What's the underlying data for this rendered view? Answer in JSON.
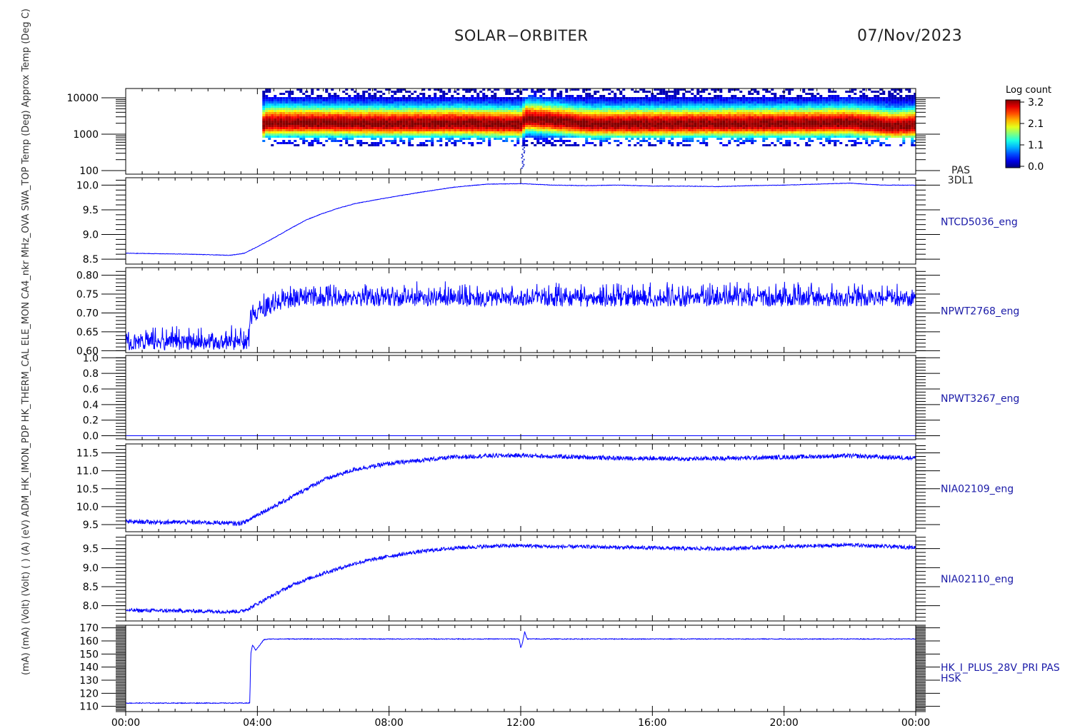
{
  "header": {
    "mission": "SOLAR−ORBITER",
    "date": "07/Nov/2023"
  },
  "colorbar": {
    "title": "Log count",
    "ticks": [
      "3.2",
      "2.1",
      "1.1",
      "0.0"
    ]
  },
  "colors": {
    "axes": "#000000",
    "trace": "#0000ff",
    "label": "#1a1aa8"
  },
  "x_ticks": [
    "00:00",
    "04:00",
    "08:00",
    "12:00",
    "16:00",
    "20:00",
    "00:00"
  ],
  "y_axis_stack_label": "(mA)  (mA)  (Volt)  (Volt)  ( )  (A)  (eV)  ADM_HK_IMON_PDP  HK_THERM_CAL  ELE_MON  CA4_nkr  MHz_OVA  SWA_TOP  Temp (Deg)  Approx Temp (Deg C)",
  "chart_data": [
    {
      "type": "heatmap",
      "id": "pas-spectrogram",
      "right_label": [
        "PAS",
        "3DL1"
      ],
      "ylabel": "E (eV)",
      "yscale": "log",
      "ylim": [
        80,
        18000
      ],
      "ytick_labels": [
        "10000",
        "1000",
        "100"
      ],
      "colorscale": "Log count",
      "clim": [
        0.0,
        3.2
      ],
      "data_start_hour": 4.15,
      "data_end_hour": 24,
      "energy_band_low_eV": 500,
      "energy_band_high_eV": 18000,
      "peak_energy_eV": [
        [
          4.2,
          2000
        ],
        [
          6.0,
          2000
        ],
        [
          8.0,
          1900
        ],
        [
          10.0,
          1950
        ],
        [
          12.0,
          1800
        ],
        [
          12.1,
          2600
        ],
        [
          14.0,
          1850
        ],
        [
          16.0,
          1850
        ],
        [
          18.0,
          1900
        ],
        [
          20.0,
          1900
        ],
        [
          22.0,
          2000
        ],
        [
          23.3,
          1600
        ],
        [
          24.0,
          1750
        ]
      ]
    },
    {
      "type": "line",
      "id": "NTCD5036_eng",
      "right_label": [
        "NTCD5036_eng"
      ],
      "ylim": [
        8.4,
        10.15
      ],
      "yticks": [
        8.5,
        9.0,
        9.5,
        10.0
      ],
      "ytick_labels": [
        "8.5",
        "9.0",
        "9.5",
        "10.0"
      ],
      "noise": 0.005,
      "points": [
        [
          0,
          8.62
        ],
        [
          1,
          8.61
        ],
        [
          2,
          8.6
        ],
        [
          3,
          8.58
        ],
        [
          3.2,
          8.58
        ],
        [
          3.6,
          8.62
        ],
        [
          4,
          8.75
        ],
        [
          4.5,
          8.93
        ],
        [
          5,
          9.12
        ],
        [
          5.5,
          9.3
        ],
        [
          6,
          9.43
        ],
        [
          6.5,
          9.54
        ],
        [
          7,
          9.63
        ],
        [
          8,
          9.75
        ],
        [
          9,
          9.86
        ],
        [
          10,
          9.96
        ],
        [
          11,
          10.02
        ],
        [
          12,
          10.03
        ],
        [
          13,
          10.0
        ],
        [
          14,
          9.99
        ],
        [
          15,
          10.0
        ],
        [
          16,
          9.98
        ],
        [
          17,
          9.98
        ],
        [
          18,
          9.97
        ],
        [
          19,
          9.99
        ],
        [
          20,
          10.0
        ],
        [
          21,
          10.02
        ],
        [
          22,
          10.04
        ],
        [
          23,
          10.0
        ],
        [
          24,
          10.0
        ]
      ]
    },
    {
      "type": "line",
      "id": "NPWT2768_eng",
      "right_label": [
        "NPWT2768_eng"
      ],
      "ylim": [
        0.595,
        0.82
      ],
      "yticks": [
        0.6,
        0.65,
        0.7,
        0.75,
        0.8
      ],
      "ytick_labels": [
        "0.60",
        "0.65",
        "0.70",
        "0.75",
        "0.80"
      ],
      "noise": 0.018,
      "points": [
        [
          0,
          0.62
        ],
        [
          3.5,
          0.62
        ],
        [
          3.75,
          0.62
        ],
        [
          3.77,
          0.685
        ],
        [
          4.0,
          0.695
        ],
        [
          4.3,
          0.71
        ],
        [
          4.7,
          0.725
        ],
        [
          5.5,
          0.735
        ],
        [
          8,
          0.735
        ],
        [
          12,
          0.735
        ],
        [
          16,
          0.735
        ],
        [
          20,
          0.735
        ],
        [
          24,
          0.735
        ]
      ]
    },
    {
      "type": "line",
      "id": "NPWT3267_eng",
      "right_label": [
        "NPWT3267_eng"
      ],
      "ylim": [
        -0.05,
        1.03
      ],
      "yticks": [
        0.0,
        0.2,
        0.4,
        0.6,
        0.8,
        1.0
      ],
      "ytick_labels": [
        "0.0",
        "0.2",
        "0.4",
        "0.6",
        "0.8",
        "1.0"
      ],
      "noise": 0.0,
      "points": [
        [
          0,
          0.0
        ],
        [
          24,
          0.0
        ]
      ]
    },
    {
      "type": "line",
      "id": "NIA02109_eng",
      "right_label": [
        "NIA02109_eng"
      ],
      "ylim": [
        9.3,
        11.75
      ],
      "yticks": [
        9.5,
        10.0,
        10.5,
        11.0,
        11.5
      ],
      "ytick_labels": [
        "9.5",
        "10.0",
        "10.5",
        "11.0",
        "11.5"
      ],
      "noise": 0.06,
      "points": [
        [
          0,
          9.58
        ],
        [
          3,
          9.55
        ],
        [
          3.4,
          9.52
        ],
        [
          3.7,
          9.6
        ],
        [
          4,
          9.78
        ],
        [
          4.5,
          10.0
        ],
        [
          5,
          10.25
        ],
        [
          5.5,
          10.5
        ],
        [
          6,
          10.75
        ],
        [
          6.5,
          10.9
        ],
        [
          7,
          11.05
        ],
        [
          8,
          11.2
        ],
        [
          9,
          11.3
        ],
        [
          10,
          11.38
        ],
        [
          11,
          11.42
        ],
        [
          12,
          11.43
        ],
        [
          13,
          11.4
        ],
        [
          14,
          11.38
        ],
        [
          15,
          11.35
        ],
        [
          16,
          11.35
        ],
        [
          17,
          11.33
        ],
        [
          18,
          11.35
        ],
        [
          19,
          11.36
        ],
        [
          20,
          11.38
        ],
        [
          21,
          11.4
        ],
        [
          22,
          11.42
        ],
        [
          23,
          11.38
        ],
        [
          24,
          11.36
        ]
      ]
    },
    {
      "type": "line",
      "id": "NIA02110_eng",
      "right_label": [
        "NIA02110_eng"
      ],
      "ylim": [
        7.6,
        9.85
      ],
      "yticks": [
        8.0,
        8.5,
        9.0,
        9.5
      ],
      "ytick_labels": [
        "8.0",
        "8.5",
        "9.0",
        "9.5"
      ],
      "noise": 0.05,
      "points": [
        [
          0,
          7.88
        ],
        [
          3,
          7.85
        ],
        [
          3.5,
          7.85
        ],
        [
          3.8,
          7.95
        ],
        [
          4.2,
          8.15
        ],
        [
          4.7,
          8.38
        ],
        [
          5.2,
          8.6
        ],
        [
          6,
          8.85
        ],
        [
          7,
          9.12
        ],
        [
          8,
          9.3
        ],
        [
          9,
          9.43
        ],
        [
          10,
          9.52
        ],
        [
          11,
          9.56
        ],
        [
          12,
          9.58
        ],
        [
          13,
          9.55
        ],
        [
          14,
          9.55
        ],
        [
          15,
          9.53
        ],
        [
          16,
          9.52
        ],
        [
          17,
          9.5
        ],
        [
          18,
          9.5
        ],
        [
          19,
          9.52
        ],
        [
          20,
          9.55
        ],
        [
          21,
          9.57
        ],
        [
          22,
          9.6
        ],
        [
          23,
          9.56
        ],
        [
          24,
          9.53
        ]
      ]
    },
    {
      "type": "line",
      "id": "HK_I_PLUS_28V_PRI",
      "right_label": [
        "HK_I_PLUS_28V_PRI PAS",
        "HSK"
      ],
      "ylim": [
        106,
        172
      ],
      "yticks": [
        110,
        120,
        130,
        140,
        150,
        160,
        170
      ],
      "ytick_labels": [
        "110",
        "120",
        "130",
        "140",
        "150",
        "160",
        "170"
      ],
      "noise": 0.3,
      "points": [
        [
          0,
          112.5
        ],
        [
          3.75,
          112.5
        ],
        [
          3.77,
          113
        ],
        [
          3.8,
          150
        ],
        [
          3.85,
          157
        ],
        [
          3.95,
          153
        ],
        [
          4.05,
          156
        ],
        [
          4.2,
          161
        ],
        [
          4.4,
          161.5
        ],
        [
          8,
          161.5
        ],
        [
          11.95,
          161.5
        ],
        [
          12.0,
          155
        ],
        [
          12.05,
          158
        ],
        [
          12.12,
          167
        ],
        [
          12.2,
          161.5
        ],
        [
          16,
          161.5
        ],
        [
          20,
          161.5
        ],
        [
          24,
          161.5
        ]
      ]
    }
  ]
}
